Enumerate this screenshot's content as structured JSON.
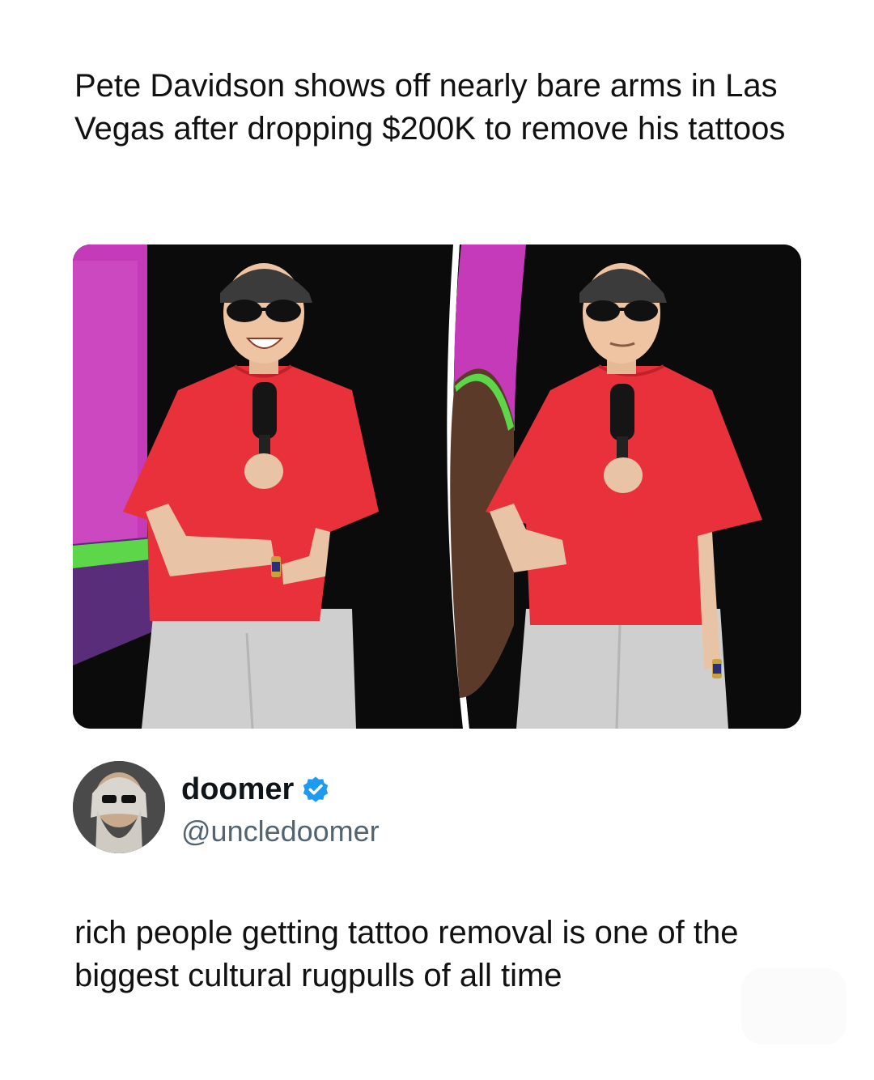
{
  "post": {
    "headline": "Pete Davidson shows off nearly bare arms in Las Vegas after dropping $200K to remove his tattoos"
  },
  "author": {
    "display_name": "doomer",
    "handle": "@uncledoomer",
    "verified_icon": "verified-badge-icon",
    "verified_color": "#1d9bf0"
  },
  "tweet": {
    "text": "rich people getting tattoo removal is one of the biggest cultural rugpulls of all time"
  },
  "colors": {
    "shirt": "#e8313a",
    "pants": "#cfcfcf",
    "stage_bg": "#0b0b0b",
    "screen_magenta": "#c43ab8",
    "screen_green": "#5ed64a"
  }
}
